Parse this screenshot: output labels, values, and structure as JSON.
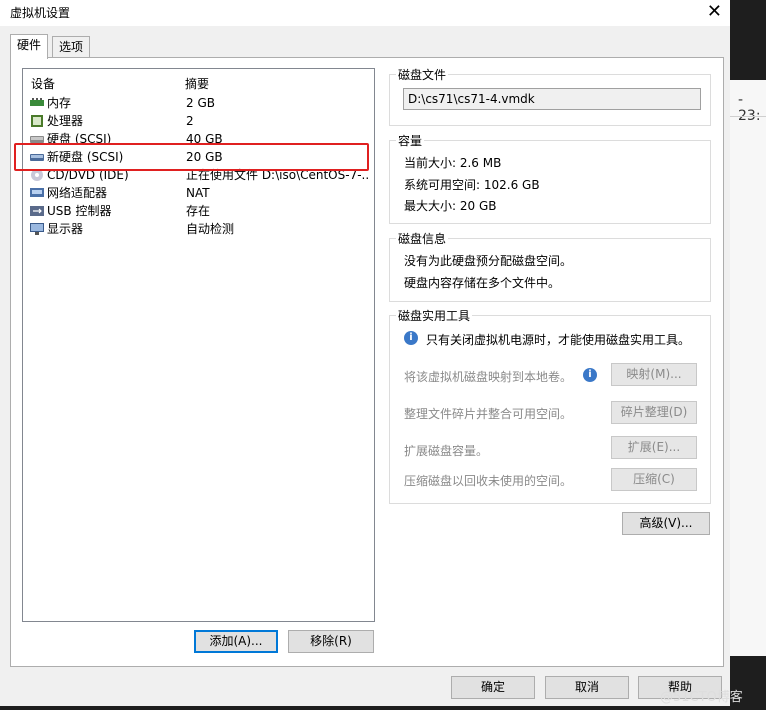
{
  "window": {
    "title": "虚拟机设置",
    "close_glyph": "✕"
  },
  "tabs": [
    {
      "label": "硬件"
    },
    {
      "label": "选项"
    }
  ],
  "device_list": {
    "col_device": "设备",
    "col_summary": "摘要",
    "items": [
      {
        "name": "内存",
        "summary": "2 GB",
        "icon": "memory-icon"
      },
      {
        "name": "处理器",
        "summary": "2",
        "icon": "processor-icon"
      },
      {
        "name": "硬盘 (SCSI)",
        "summary": "40 GB",
        "icon": "hard-disk-icon"
      },
      {
        "name": "新硬盘 (SCSI)",
        "summary": "20 GB",
        "icon": "hard-disk-icon",
        "selected": true
      },
      {
        "name": "CD/DVD (IDE)",
        "summary": "正在使用文件 D:\\iso\\CentOS-7-...",
        "icon": "cd-dvd-icon"
      },
      {
        "name": "网络适配器",
        "summary": "NAT",
        "icon": "network-adapter-icon"
      },
      {
        "name": "USB 控制器",
        "summary": "存在",
        "icon": "usb-controller-icon"
      },
      {
        "name": "显示器",
        "summary": "自动检测",
        "icon": "display-icon"
      }
    ]
  },
  "buttons": {
    "add": {
      "label": "添加(A)..."
    },
    "remove": {
      "label": "移除(R)"
    },
    "advanced": {
      "label": "高级(V)..."
    },
    "ok": {
      "label": "确定"
    },
    "cancel": {
      "label": "取消"
    },
    "help": {
      "label": "帮助"
    }
  },
  "disk_file": {
    "title": "磁盘文件",
    "path": "D:\\cs71\\cs71-4.vmdk"
  },
  "capacity": {
    "title": "容量",
    "current_size": "当前大小: 2.6 MB",
    "available": "系统可用空间: 102.6 GB",
    "max_size": "最大大小: 20 GB"
  },
  "disk_info": {
    "title": "磁盘信息",
    "line1": "没有为此硬盘预分配磁盘空间。",
    "line2": "硬盘内容存储在多个文件中。"
  },
  "utilities": {
    "title": "磁盘实用工具",
    "note": "只有关闭虚拟机电源时，才能使用磁盘实用工具。",
    "map_desc": "将该虚拟机磁盘映射到本地卷。",
    "map_btn": "映射(M)...",
    "defrag_desc": "整理文件碎片并整合可用空间。",
    "defrag_btn": "碎片整理(D)",
    "expand_desc": "扩展磁盘容量。",
    "expand_btn": "扩展(E)...",
    "compact_desc": "压缩磁盘以回收未使用的空间。",
    "compact_btn": "压缩(C)"
  },
  "background": {
    "time_fragment": "- 23:"
  },
  "watermark": "@51CTO博客",
  "colors": {
    "highlight": "#e02020",
    "focus": "#0078d7"
  }
}
